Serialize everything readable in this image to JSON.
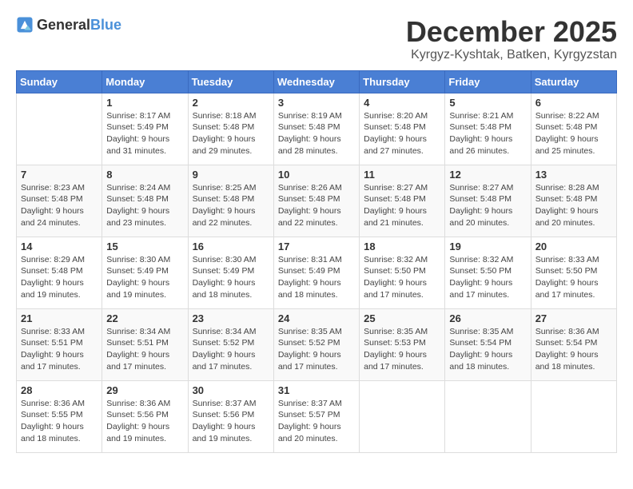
{
  "header": {
    "logo_general": "General",
    "logo_blue": "Blue",
    "month": "December 2025",
    "location": "Kyrgyz-Kyshtak, Batken, Kyrgyzstan"
  },
  "weekdays": [
    "Sunday",
    "Monday",
    "Tuesday",
    "Wednesday",
    "Thursday",
    "Friday",
    "Saturday"
  ],
  "weeks": [
    [
      {
        "day": "",
        "info": ""
      },
      {
        "day": "1",
        "info": "Sunrise: 8:17 AM\nSunset: 5:49 PM\nDaylight: 9 hours\nand 31 minutes."
      },
      {
        "day": "2",
        "info": "Sunrise: 8:18 AM\nSunset: 5:48 PM\nDaylight: 9 hours\nand 29 minutes."
      },
      {
        "day": "3",
        "info": "Sunrise: 8:19 AM\nSunset: 5:48 PM\nDaylight: 9 hours\nand 28 minutes."
      },
      {
        "day": "4",
        "info": "Sunrise: 8:20 AM\nSunset: 5:48 PM\nDaylight: 9 hours\nand 27 minutes."
      },
      {
        "day": "5",
        "info": "Sunrise: 8:21 AM\nSunset: 5:48 PM\nDaylight: 9 hours\nand 26 minutes."
      },
      {
        "day": "6",
        "info": "Sunrise: 8:22 AM\nSunset: 5:48 PM\nDaylight: 9 hours\nand 25 minutes."
      }
    ],
    [
      {
        "day": "7",
        "info": "Sunrise: 8:23 AM\nSunset: 5:48 PM\nDaylight: 9 hours\nand 24 minutes."
      },
      {
        "day": "8",
        "info": "Sunrise: 8:24 AM\nSunset: 5:48 PM\nDaylight: 9 hours\nand 23 minutes."
      },
      {
        "day": "9",
        "info": "Sunrise: 8:25 AM\nSunset: 5:48 PM\nDaylight: 9 hours\nand 22 minutes."
      },
      {
        "day": "10",
        "info": "Sunrise: 8:26 AM\nSunset: 5:48 PM\nDaylight: 9 hours\nand 22 minutes."
      },
      {
        "day": "11",
        "info": "Sunrise: 8:27 AM\nSunset: 5:48 PM\nDaylight: 9 hours\nand 21 minutes."
      },
      {
        "day": "12",
        "info": "Sunrise: 8:27 AM\nSunset: 5:48 PM\nDaylight: 9 hours\nand 20 minutes."
      },
      {
        "day": "13",
        "info": "Sunrise: 8:28 AM\nSunset: 5:48 PM\nDaylight: 9 hours\nand 20 minutes."
      }
    ],
    [
      {
        "day": "14",
        "info": "Sunrise: 8:29 AM\nSunset: 5:48 PM\nDaylight: 9 hours\nand 19 minutes."
      },
      {
        "day": "15",
        "info": "Sunrise: 8:30 AM\nSunset: 5:49 PM\nDaylight: 9 hours\nand 19 minutes."
      },
      {
        "day": "16",
        "info": "Sunrise: 8:30 AM\nSunset: 5:49 PM\nDaylight: 9 hours\nand 18 minutes."
      },
      {
        "day": "17",
        "info": "Sunrise: 8:31 AM\nSunset: 5:49 PM\nDaylight: 9 hours\nand 18 minutes."
      },
      {
        "day": "18",
        "info": "Sunrise: 8:32 AM\nSunset: 5:50 PM\nDaylight: 9 hours\nand 17 minutes."
      },
      {
        "day": "19",
        "info": "Sunrise: 8:32 AM\nSunset: 5:50 PM\nDaylight: 9 hours\nand 17 minutes."
      },
      {
        "day": "20",
        "info": "Sunrise: 8:33 AM\nSunset: 5:50 PM\nDaylight: 9 hours\nand 17 minutes."
      }
    ],
    [
      {
        "day": "21",
        "info": "Sunrise: 8:33 AM\nSunset: 5:51 PM\nDaylight: 9 hours\nand 17 minutes."
      },
      {
        "day": "22",
        "info": "Sunrise: 8:34 AM\nSunset: 5:51 PM\nDaylight: 9 hours\nand 17 minutes."
      },
      {
        "day": "23",
        "info": "Sunrise: 8:34 AM\nSunset: 5:52 PM\nDaylight: 9 hours\nand 17 minutes."
      },
      {
        "day": "24",
        "info": "Sunrise: 8:35 AM\nSunset: 5:52 PM\nDaylight: 9 hours\nand 17 minutes."
      },
      {
        "day": "25",
        "info": "Sunrise: 8:35 AM\nSunset: 5:53 PM\nDaylight: 9 hours\nand 17 minutes."
      },
      {
        "day": "26",
        "info": "Sunrise: 8:35 AM\nSunset: 5:54 PM\nDaylight: 9 hours\nand 18 minutes."
      },
      {
        "day": "27",
        "info": "Sunrise: 8:36 AM\nSunset: 5:54 PM\nDaylight: 9 hours\nand 18 minutes."
      }
    ],
    [
      {
        "day": "28",
        "info": "Sunrise: 8:36 AM\nSunset: 5:55 PM\nDaylight: 9 hours\nand 18 minutes."
      },
      {
        "day": "29",
        "info": "Sunrise: 8:36 AM\nSunset: 5:56 PM\nDaylight: 9 hours\nand 19 minutes."
      },
      {
        "day": "30",
        "info": "Sunrise: 8:37 AM\nSunset: 5:56 PM\nDaylight: 9 hours\nand 19 minutes."
      },
      {
        "day": "31",
        "info": "Sunrise: 8:37 AM\nSunset: 5:57 PM\nDaylight: 9 hours\nand 20 minutes."
      },
      {
        "day": "",
        "info": ""
      },
      {
        "day": "",
        "info": ""
      },
      {
        "day": "",
        "info": ""
      }
    ]
  ]
}
